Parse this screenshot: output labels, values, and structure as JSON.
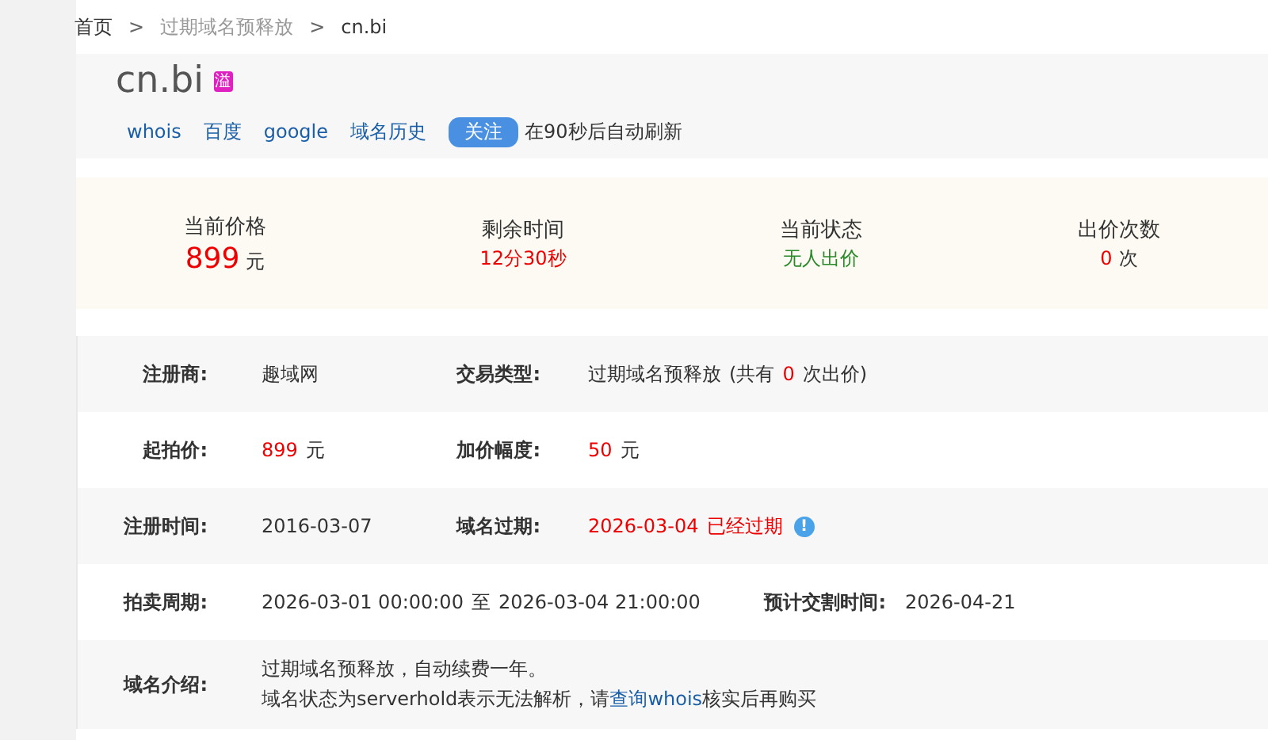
{
  "breadcrumb": [
    {
      "label": "首页",
      "kind": "link"
    },
    {
      "label": ">",
      "kind": "sep"
    },
    {
      "label": "过期域名预释放",
      "kind": "muted"
    },
    {
      "label": ">",
      "kind": "sep"
    },
    {
      "label": "cn.bi",
      "kind": "current"
    }
  ],
  "domain": {
    "name": "cn.bi",
    "badge": "溢"
  },
  "links": [
    {
      "label": "whois",
      "kind": "link"
    },
    {
      "label": "百度",
      "kind": "link"
    },
    {
      "label": "google",
      "kind": "link"
    },
    {
      "label": "域名历史",
      "kind": "link"
    },
    {
      "label": "关注",
      "kind": "pill"
    },
    {
      "label": "在90秒后自动刷新",
      "kind": "text"
    }
  ],
  "stats": [
    {
      "label": "当前价格",
      "parts": [
        {
          "text": "899",
          "kind": "big"
        },
        {
          "text": "元",
          "kind": "plain"
        }
      ]
    },
    {
      "label": "剩余时间",
      "parts": [
        {
          "text": "12分30秒",
          "kind": "red"
        }
      ]
    },
    {
      "label": "当前状态",
      "parts": [
        {
          "text": "无人出价",
          "kind": "green"
        }
      ]
    },
    {
      "label": "出价次数",
      "parts": [
        {
          "text": "0",
          "kind": "red"
        },
        {
          "text": "次",
          "kind": "plain"
        }
      ]
    }
  ],
  "details": [
    [
      {
        "label": "注册商:",
        "parts": [
          {
            "text": "趣域网",
            "kind": "plain"
          }
        ]
      },
      {
        "label": "交易类型:",
        "parts": [
          {
            "text": "过期域名预释放",
            "kind": "plain"
          },
          {
            "text": "(共有",
            "kind": "plain"
          },
          {
            "text": "0",
            "kind": "red"
          },
          {
            "text": "次出价)",
            "kind": "plain"
          }
        ]
      }
    ],
    [
      {
        "label": "起拍价:",
        "parts": [
          {
            "text": "899",
            "kind": "red"
          },
          {
            "text": "元",
            "kind": "plain"
          }
        ]
      },
      {
        "label": "加价幅度:",
        "parts": [
          {
            "text": "50",
            "kind": "red"
          },
          {
            "text": "元",
            "kind": "plain"
          }
        ]
      }
    ],
    [
      {
        "label": "注册时间:",
        "parts": [
          {
            "text": "2016-03-07",
            "kind": "plain"
          }
        ]
      },
      {
        "label": "域名过期:",
        "parts": [
          {
            "text": "2026-03-04",
            "kind": "red"
          },
          {
            "text": "已经过期",
            "kind": "red"
          },
          {
            "text": "!",
            "kind": "info"
          }
        ]
      }
    ],
    [
      {
        "label": "拍卖周期:",
        "parts": [
          {
            "text": "2026-03-01 00:00:00",
            "kind": "plain"
          },
          {
            "text": "至",
            "kind": "plain"
          },
          {
            "text": "2026-03-04 21:00:00",
            "kind": "plain"
          }
        ]
      },
      {
        "label": "预计交割时间:",
        "parts": [
          {
            "text": "2026-04-21",
            "kind": "plain"
          }
        ]
      }
    ]
  ],
  "intro": {
    "label": "域名介绍:",
    "lines": [
      [
        {
          "text": "过期域名预释放，自动续费一年。",
          "kind": "plain"
        }
      ],
      [
        {
          "text": "域名状态为serverhold表示无法解析，请",
          "kind": "plain"
        },
        {
          "text": "查询whois",
          "kind": "link"
        },
        {
          "text": "核实后再购买",
          "kind": "plain"
        }
      ]
    ]
  }
}
